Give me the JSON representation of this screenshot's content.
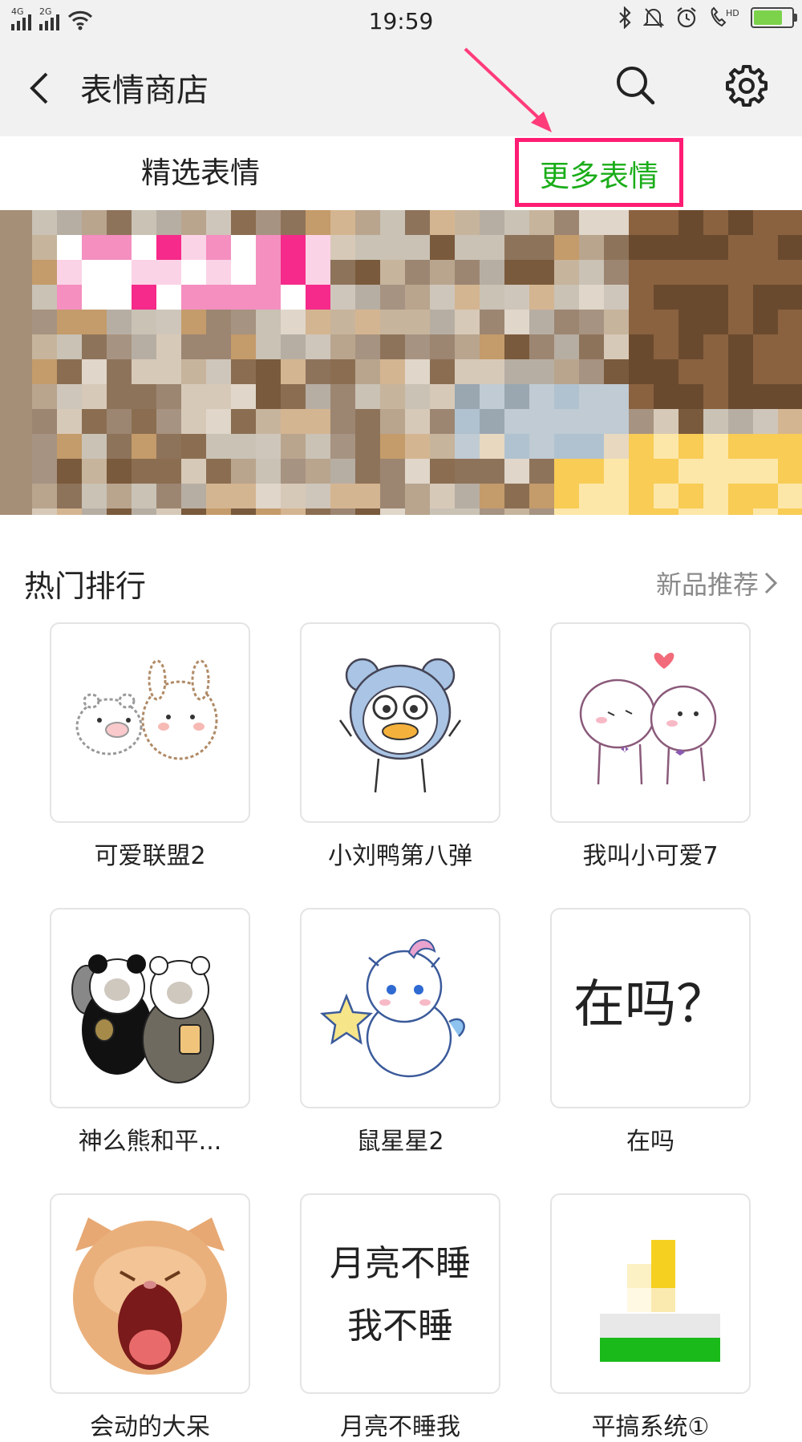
{
  "status_bar": {
    "time": "19:59",
    "sim1_label": "4G",
    "sim2_label": "2G",
    "icons": [
      "signal-icon",
      "signal-icon",
      "wifi-icon",
      "bluetooth-icon",
      "bell-off-icon",
      "alarm-icon",
      "hd-call-icon",
      "battery-icon"
    ]
  },
  "app_bar": {
    "title": "表情商店",
    "back_icon": "chevron-left-icon",
    "search_icon": "search-icon",
    "settings_icon": "gear-icon"
  },
  "tabs": [
    {
      "label": "精选表情",
      "selected": false
    },
    {
      "label": "更多表情",
      "selected": true,
      "highlight_color": "#ff1c73",
      "text_color": "#1aad19"
    }
  ],
  "hot_section": {
    "title": "热门排行",
    "more_link": "新品推荐"
  },
  "stickers": [
    {
      "name": "可爱联盟2",
      "art": "pig-rabbit"
    },
    {
      "name": "小刘鸭第八弹",
      "art": "duck-mouse"
    },
    {
      "name": "我叫小可爱7",
      "art": "bears-kiss"
    },
    {
      "name": "神么熊和平...",
      "art": "panda-bears"
    },
    {
      "name": "鼠星星2",
      "art": "unicorn-star"
    },
    {
      "name": "在吗",
      "art": "text",
      "art_text": "在吗？"
    },
    {
      "name": "会动的大呆",
      "art": "cat"
    },
    {
      "name": "月亮不睡我",
      "art": "text2",
      "art_lines": [
        "月亮不睡",
        "我不睡"
      ]
    },
    {
      "name": "平搞系统①",
      "art": "pixel"
    }
  ],
  "colors": {
    "accent_green": "#1aad19",
    "highlight_pink": "#ff1c73",
    "bar_gray": "#f1f1f1"
  }
}
